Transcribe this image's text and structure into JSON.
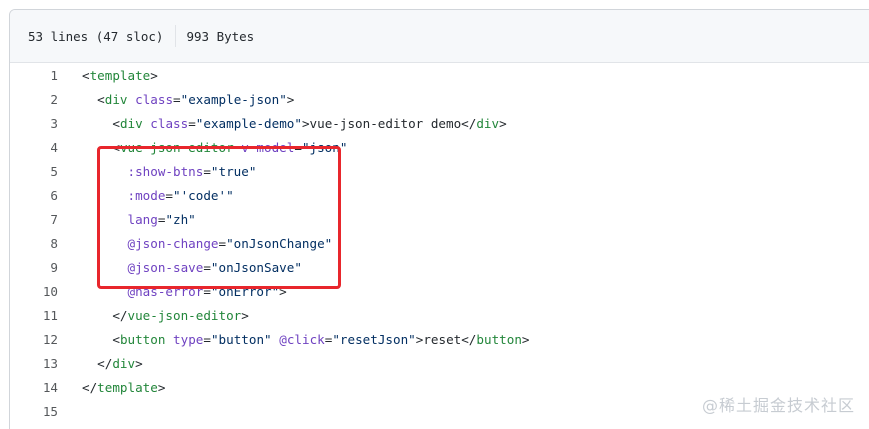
{
  "header": {
    "lines_info": "53 lines (47 sloc)",
    "size_info": "993 Bytes"
  },
  "code": {
    "lines": [
      {
        "num": "1",
        "indent": "",
        "tokens": [
          [
            "punc",
            "<"
          ],
          [
            "tag",
            "template"
          ],
          [
            "punc",
            ">"
          ]
        ]
      },
      {
        "num": "2",
        "indent": "  ",
        "tokens": [
          [
            "punc",
            "<"
          ],
          [
            "tag",
            "div"
          ],
          [
            "punc",
            " "
          ],
          [
            "attr",
            "class"
          ],
          [
            "punc",
            "="
          ],
          [
            "str",
            "\"example-json\""
          ],
          [
            "punc",
            ">"
          ]
        ]
      },
      {
        "num": "3",
        "indent": "    ",
        "tokens": [
          [
            "punc",
            "<"
          ],
          [
            "tag",
            "div"
          ],
          [
            "punc",
            " "
          ],
          [
            "attr",
            "class"
          ],
          [
            "punc",
            "="
          ],
          [
            "str",
            "\"example-demo\""
          ],
          [
            "punc",
            ">vue-json-editor demo</"
          ],
          [
            "tag",
            "div"
          ],
          [
            "punc",
            ">"
          ]
        ]
      },
      {
        "num": "4",
        "indent": "    ",
        "tokens": [
          [
            "punc",
            "<"
          ],
          [
            "tag",
            "vue-json-editor"
          ],
          [
            "punc",
            " "
          ],
          [
            "attr",
            "v-model"
          ],
          [
            "punc",
            "="
          ],
          [
            "str",
            "\"json\""
          ]
        ]
      },
      {
        "num": "5",
        "indent": "      ",
        "tokens": [
          [
            "attr",
            ":show-btns"
          ],
          [
            "punc",
            "="
          ],
          [
            "str",
            "\"true\""
          ]
        ]
      },
      {
        "num": "6",
        "indent": "      ",
        "tokens": [
          [
            "attr",
            ":mode"
          ],
          [
            "punc",
            "="
          ],
          [
            "str",
            "\"'code'\""
          ]
        ]
      },
      {
        "num": "7",
        "indent": "      ",
        "tokens": [
          [
            "attr",
            "lang"
          ],
          [
            "punc",
            "="
          ],
          [
            "str",
            "\"zh\""
          ]
        ]
      },
      {
        "num": "8",
        "indent": "      ",
        "tokens": [
          [
            "attr",
            "@json-change"
          ],
          [
            "punc",
            "="
          ],
          [
            "str",
            "\"onJsonChange\""
          ]
        ]
      },
      {
        "num": "9",
        "indent": "      ",
        "tokens": [
          [
            "attr",
            "@json-save"
          ],
          [
            "punc",
            "="
          ],
          [
            "str",
            "\"onJsonSave\""
          ]
        ]
      },
      {
        "num": "10",
        "indent": "      ",
        "tokens": [
          [
            "attr",
            "@has-error"
          ],
          [
            "punc",
            "="
          ],
          [
            "str",
            "\"onError\""
          ],
          [
            "punc",
            ">"
          ]
        ]
      },
      {
        "num": "11",
        "indent": "    ",
        "tokens": [
          [
            "punc",
            "</"
          ],
          [
            "tag",
            "vue-json-editor"
          ],
          [
            "punc",
            ">"
          ]
        ]
      },
      {
        "num": "12",
        "indent": "    ",
        "tokens": [
          [
            "punc",
            "<"
          ],
          [
            "tag",
            "button"
          ],
          [
            "punc",
            " "
          ],
          [
            "attr",
            "type"
          ],
          [
            "punc",
            "="
          ],
          [
            "str",
            "\"button\""
          ],
          [
            "punc",
            " "
          ],
          [
            "attr",
            "@click"
          ],
          [
            "punc",
            "="
          ],
          [
            "str",
            "\"resetJson\""
          ],
          [
            "punc",
            ">reset</"
          ],
          [
            "tag",
            "button"
          ],
          [
            "punc",
            ">"
          ]
        ]
      },
      {
        "num": "13",
        "indent": "  ",
        "tokens": [
          [
            "punc",
            "</"
          ],
          [
            "tag",
            "div"
          ],
          [
            "punc",
            ">"
          ]
        ]
      },
      {
        "num": "14",
        "indent": "",
        "tokens": [
          [
            "punc",
            "</"
          ],
          [
            "tag",
            "template"
          ],
          [
            "punc",
            ">"
          ]
        ]
      },
      {
        "num": "15",
        "indent": "",
        "tokens": []
      }
    ]
  },
  "colors": {
    "highlight_border": "#e8262c",
    "tag": "#22863a",
    "attr": "#6f42c1",
    "string": "#032f62"
  },
  "watermark": "@稀土掘金技术社区"
}
